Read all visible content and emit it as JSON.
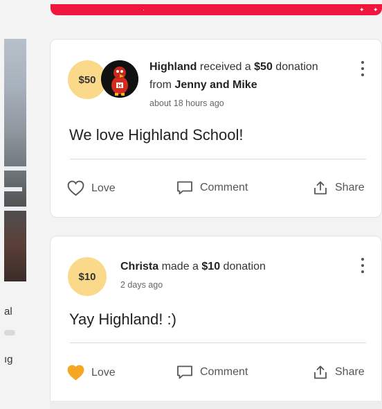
{
  "left_panel": {
    "text_1": "al",
    "text_2": "ıg"
  },
  "posts": [
    {
      "amount_badge": "$50",
      "recipient": "Highland",
      "verb": " received a ",
      "amount": "$50",
      "noun": " donation",
      "from_prefix": "from ",
      "donor": "Jenny and Mike",
      "time": "about 18 hours ago",
      "message": "We love Highland School!",
      "love_label": "Love",
      "comment_label": "Comment",
      "share_label": "Share",
      "loved": false
    },
    {
      "amount_badge": "$10",
      "donor": "Christa",
      "verb": " made a ",
      "amount": "$10",
      "noun": " donation",
      "time": "2 days ago",
      "message": "Yay Highland! :)",
      "love_label": "Love",
      "comment_label": "Comment",
      "share_label": "Share",
      "loved": true
    }
  ],
  "colors": {
    "banner": "#f0163e",
    "badge": "#fbd98a",
    "love_active": "#f5a623"
  },
  "icons": [
    "heart-icon",
    "comment-icon",
    "share-icon",
    "more-icon",
    "mascot-icon"
  ]
}
